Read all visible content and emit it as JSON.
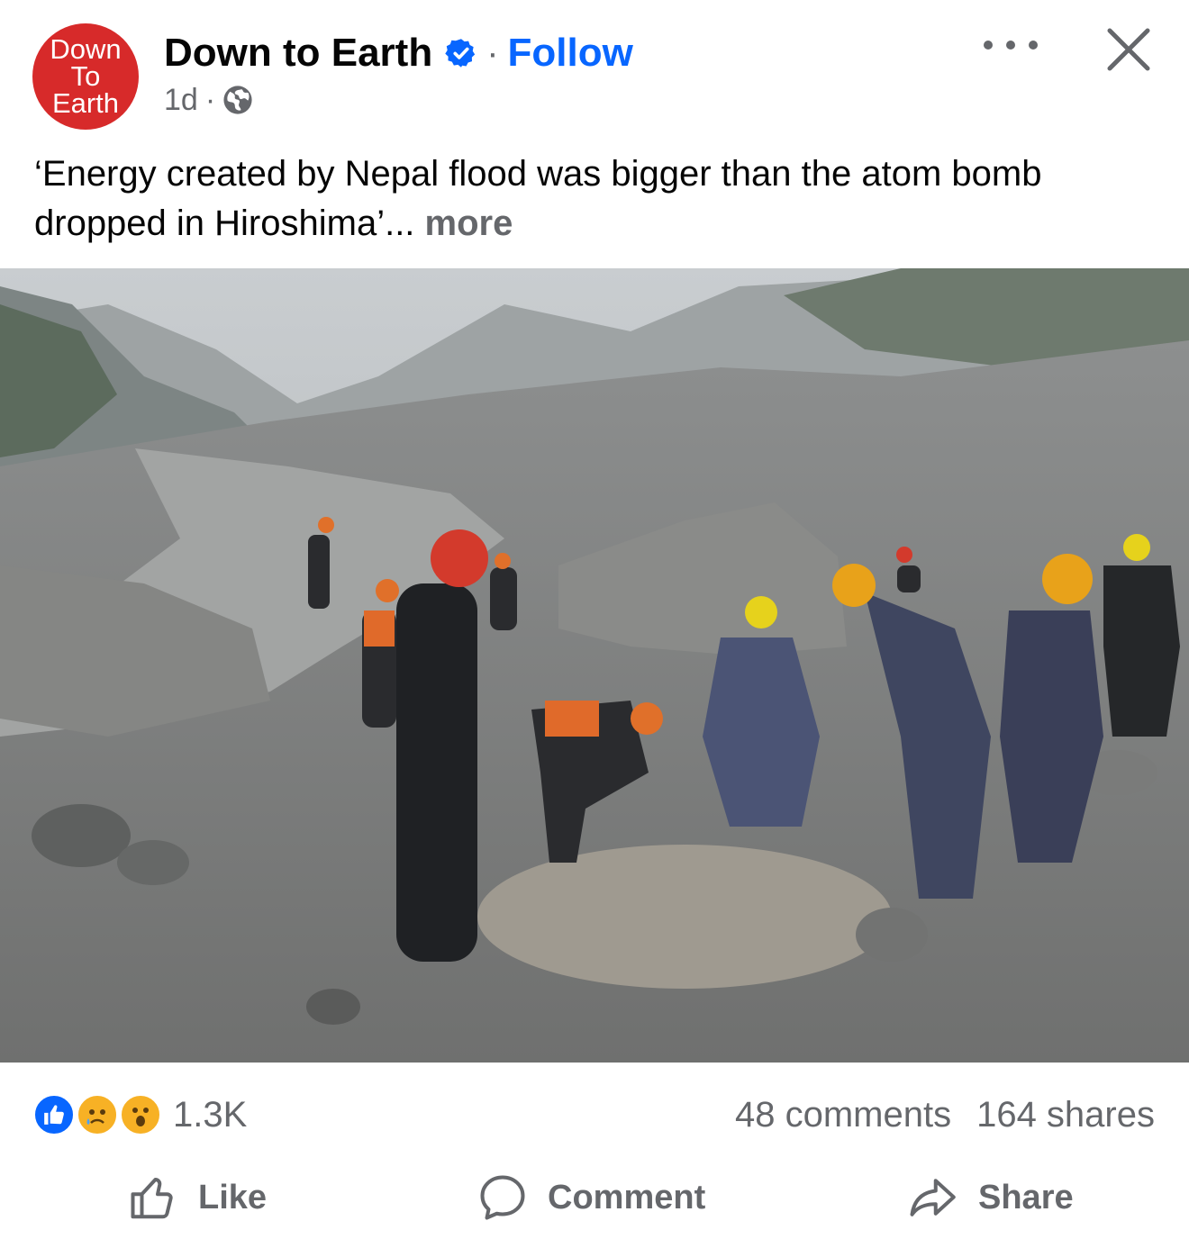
{
  "post": {
    "page_name": "Down to Earth",
    "avatar_lines": [
      "Down",
      "To",
      "Earth"
    ],
    "follow_label": "Follow",
    "dot_separator": "·",
    "timestamp": "1d",
    "audience_icon": "globe-icon",
    "caption": "‘Energy created by Nepal flood was bigger than the atom bomb dropped in Hiroshima’...",
    "more_label": "more",
    "brand_color": "#d72a2a",
    "link_color": "#0866ff"
  },
  "engagement": {
    "reaction_icons": [
      "like-icon",
      "sad-icon",
      "wow-icon"
    ],
    "reaction_count": "1.3K",
    "comments": "48 comments",
    "shares": "164 shares"
  },
  "actions": {
    "like": "Like",
    "comment": "Comment",
    "share": "Share"
  }
}
